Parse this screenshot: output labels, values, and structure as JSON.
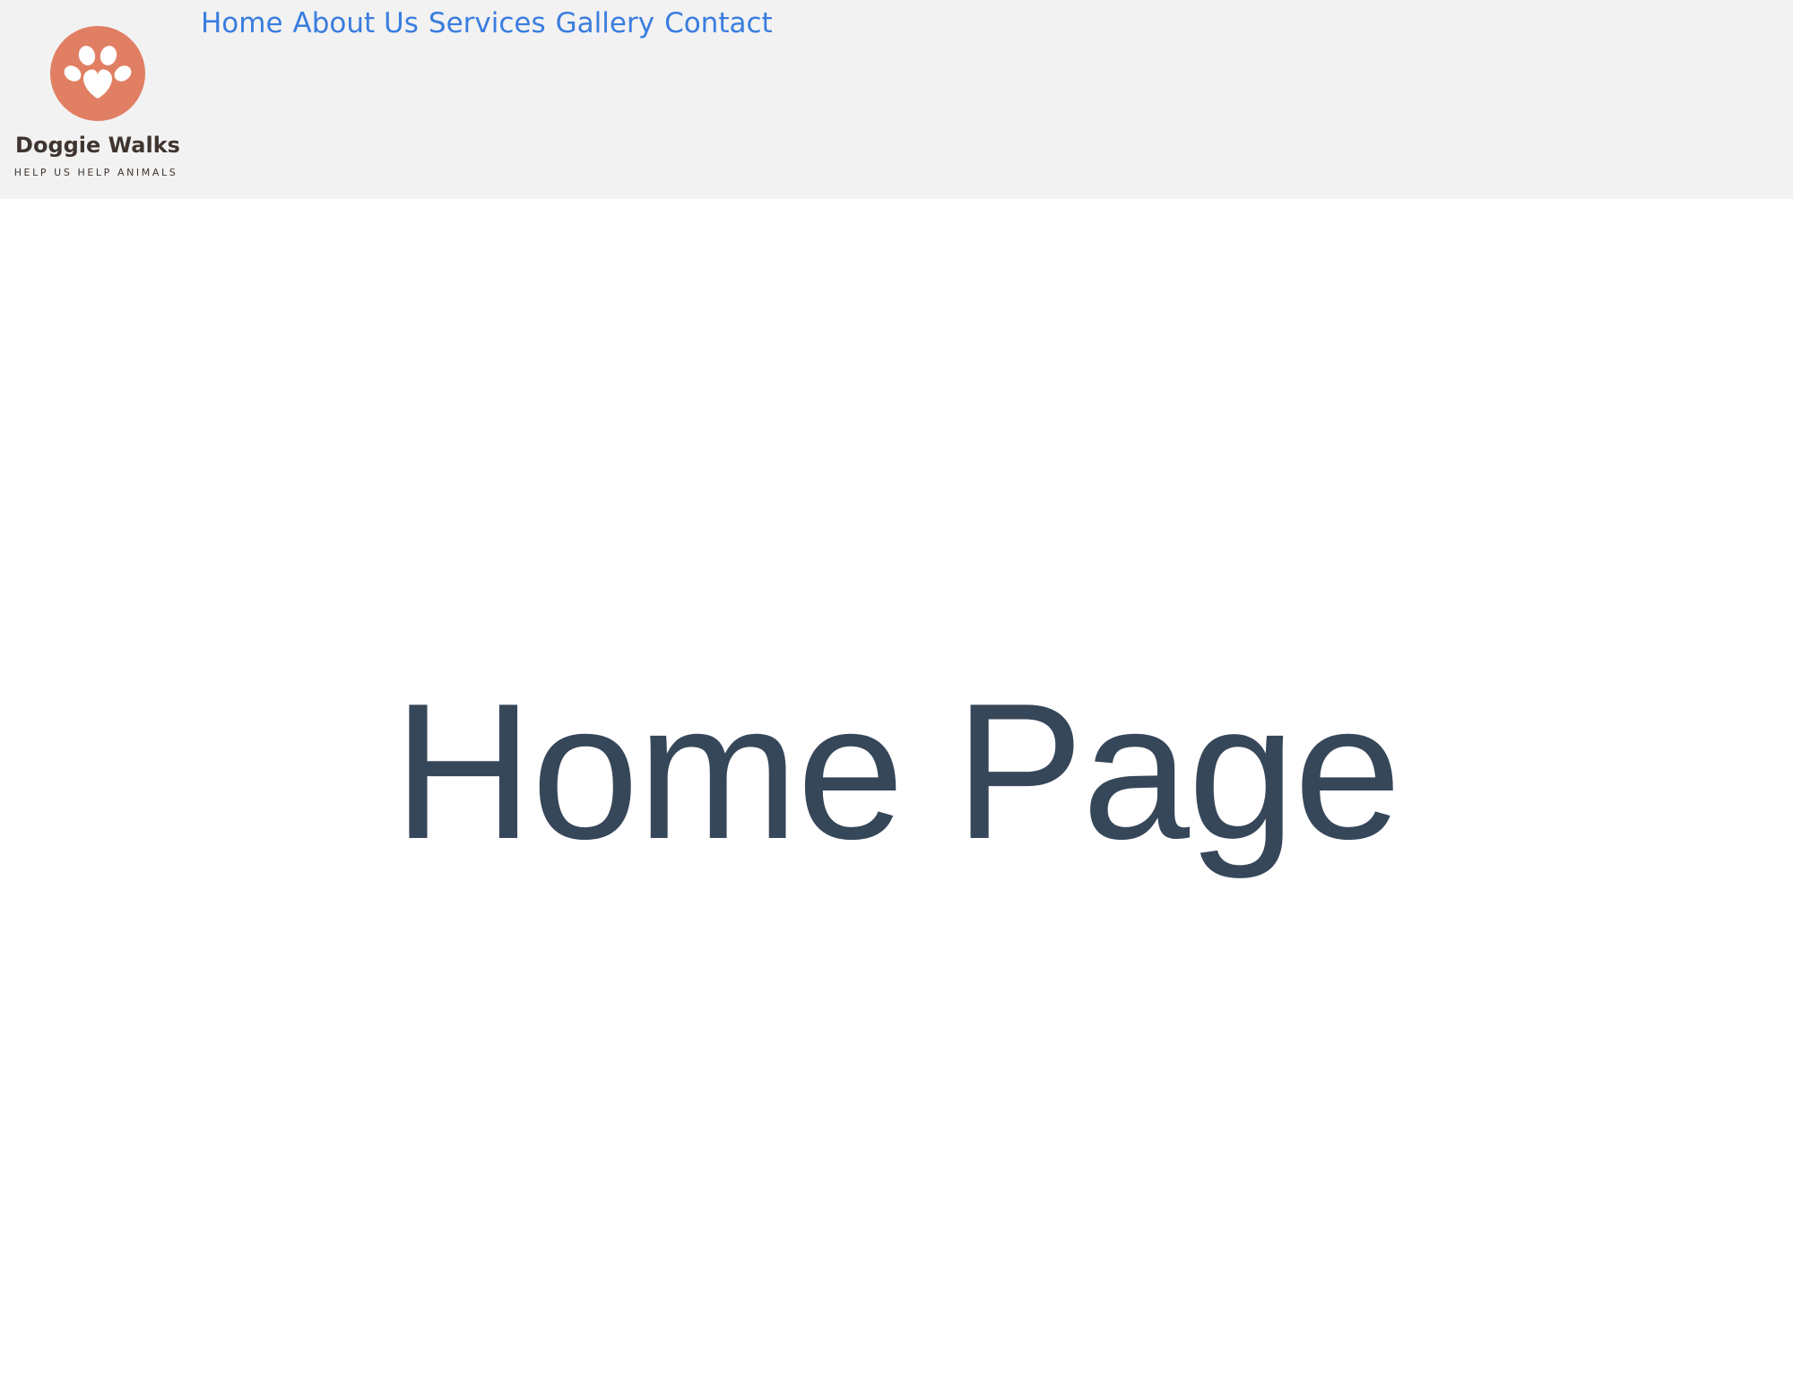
{
  "brand": {
    "name": "Doggie Walks",
    "tagline": "HELP US HELP ANIMALS",
    "logo_icon": "paw-icon",
    "logo_color": "#e07f63"
  },
  "nav": {
    "items": [
      {
        "label": "Home"
      },
      {
        "label": "About Us"
      },
      {
        "label": "Services"
      },
      {
        "label": "Gallery"
      },
      {
        "label": "Contact"
      }
    ],
    "link_color": "#3a7ddf"
  },
  "hero": {
    "title": "Home Page",
    "title_color": "#37475a"
  },
  "colors": {
    "header_bg": "#f2f2f2",
    "page_bg": "#ffffff"
  }
}
